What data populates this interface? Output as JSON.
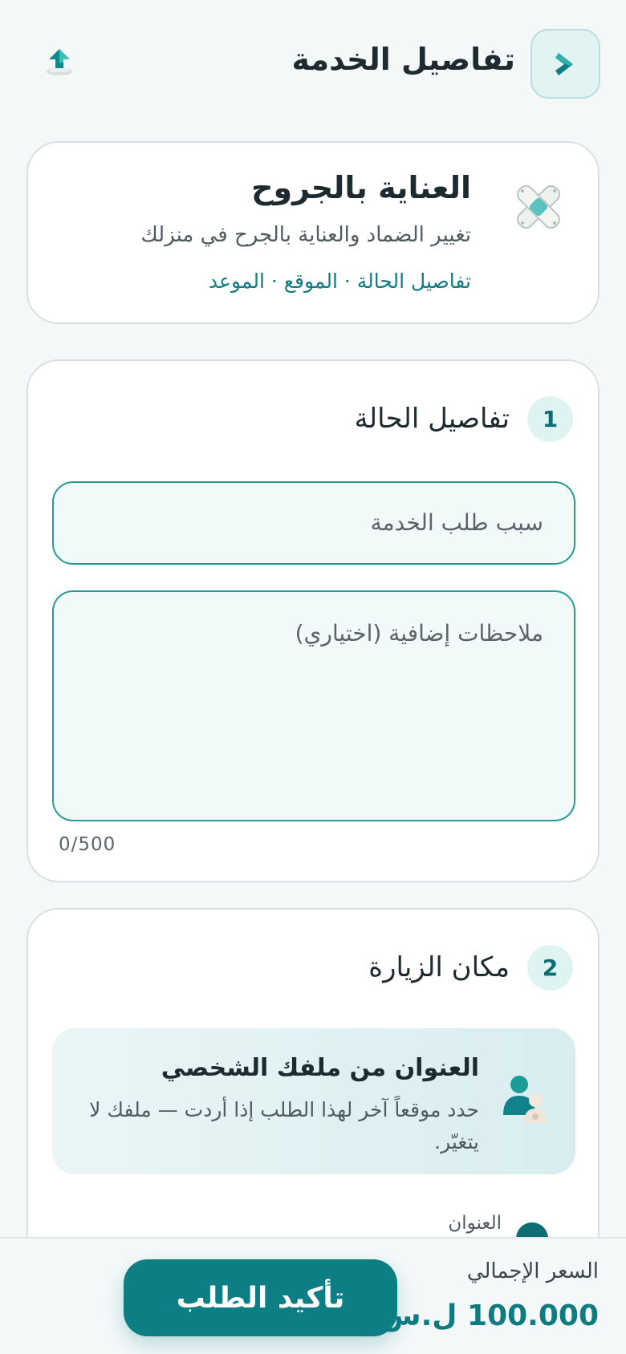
{
  "header": {
    "title": "تفاصيل الخدمة",
    "back_icon": "chevron-right-icon",
    "share_icon": "share-icon"
  },
  "service": {
    "icon": "bandage-icon",
    "title": "العناية بالجروح",
    "description": "تغيير الضماد والعناية بالجرح في منزلك",
    "steps_summary": "تفاصيل الحالة · الموقع · الموعد"
  },
  "step1": {
    "number": "1",
    "title": "تفاصيل الحالة",
    "reason_placeholder": "سبب طلب الخدمة",
    "notes_placeholder": "ملاحظات إضافية (اختياري)",
    "char_count": "0/500"
  },
  "step2": {
    "number": "2",
    "title": "مكان الزيارة",
    "banner_icon": "user-family-icon",
    "banner_title": "العنوان من ملفك الشخصي",
    "banner_desc": "حدد موقعاً آخر لهذا الطلب إذا أردت — ملفك لا يتغيّر.",
    "address_label": "العنوان"
  },
  "footer": {
    "price_label": "السعر الإجمالي",
    "price_value": "100.000 ل.س",
    "confirm_label": "تأكيد الطلب"
  },
  "colors": {
    "accent": "#0e7e85",
    "accent_light": "#dff3f3",
    "background": "#f4f8f9"
  }
}
